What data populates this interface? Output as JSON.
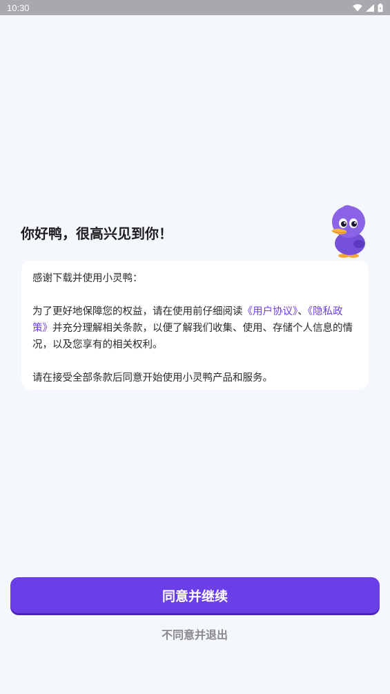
{
  "status_bar": {
    "time": "10:30",
    "icons": [
      "wifi-icon",
      "signal-icon",
      "battery-icon"
    ]
  },
  "greeting": "你好鸭，很高兴见到你！",
  "mascot": "duck-mascot",
  "card": {
    "intro": "感谢下载并使用小灵鸭：",
    "para1_before": "为了更好地保障您的权益，请在使用前仔细阅读",
    "user_agreement_link": "《用户协议》",
    "separator": "、",
    "privacy_policy_link": "《隐私政策》",
    "para1_after": "并充分理解相关条款，以便了解我们收集、使用、存储个人信息的情况，以及您享有的相关权利。",
    "para2": "请在接受全部条款后同意开始使用小灵鸭产品和服务。"
  },
  "agree_button": "同意并继续",
  "disagree_button": "不同意并退出",
  "colors": {
    "accent": "#6b3fe8",
    "link": "#6d3ee8",
    "background": "#f4f7fb",
    "status_bar": "#a8a8ad"
  }
}
